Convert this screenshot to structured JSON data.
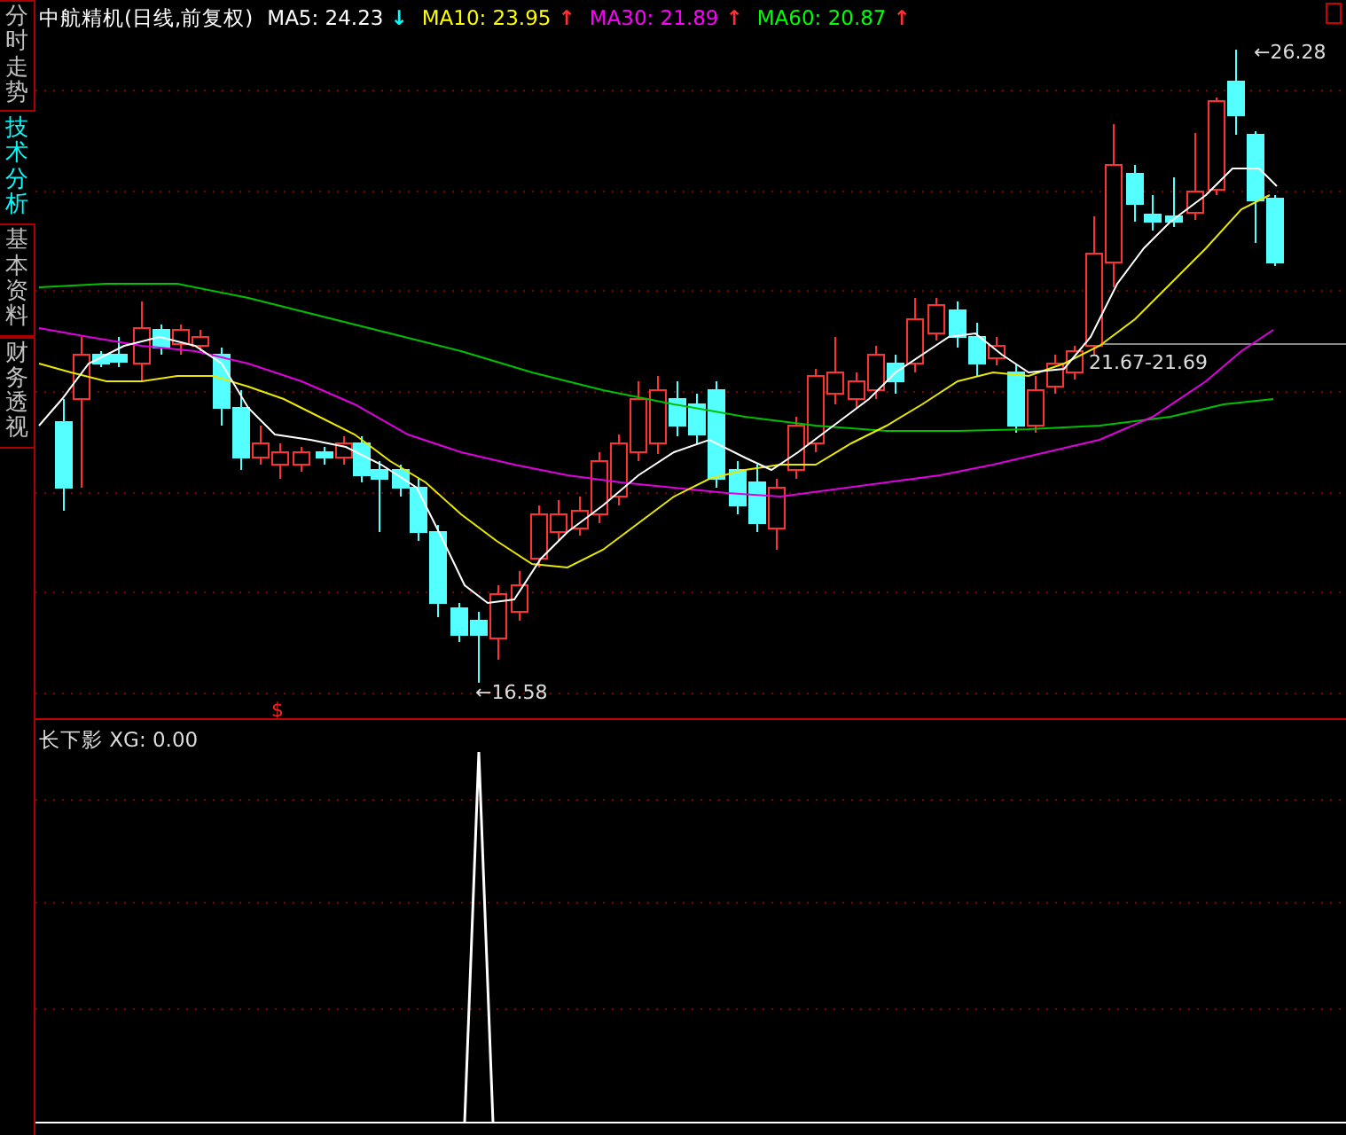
{
  "side_tabs": [
    {
      "label": "分时走势",
      "selected": false
    },
    {
      "label": "技术分析",
      "selected": true
    },
    {
      "label": "基本资料",
      "selected": false
    },
    {
      "label": "财务透视",
      "selected": false
    }
  ],
  "main_chart": {
    "title": "中航精机(日线,前复权)",
    "indicators": [
      {
        "label": "MA5: 24.23",
        "color": "#ffffff",
        "arrow": {
          "text": "↓",
          "color": "#00ffff"
        }
      },
      {
        "label": "MA10: 23.95",
        "color": "#ffff00",
        "arrow": {
          "text": "↑",
          "color": "#ff3030"
        }
      },
      {
        "label": "MA30: 21.89",
        "color": "#ff00ff",
        "arrow": {
          "text": "↑",
          "color": "#ff3030"
        }
      },
      {
        "label": "MA60: 20.87",
        "color": "#00ff00",
        "arrow": {
          "text": "↑",
          "color": "#ff3030"
        }
      }
    ],
    "price_labels": [
      {
        "kind": "high",
        "text": "←26.28"
      },
      {
        "kind": "low",
        "text": "←16.58"
      },
      {
        "kind": "range",
        "text": "21.67-21.69"
      }
    ],
    "signal_mark": "$"
  },
  "sub_chart": {
    "title": "长下影  XG: 0.00"
  }
}
